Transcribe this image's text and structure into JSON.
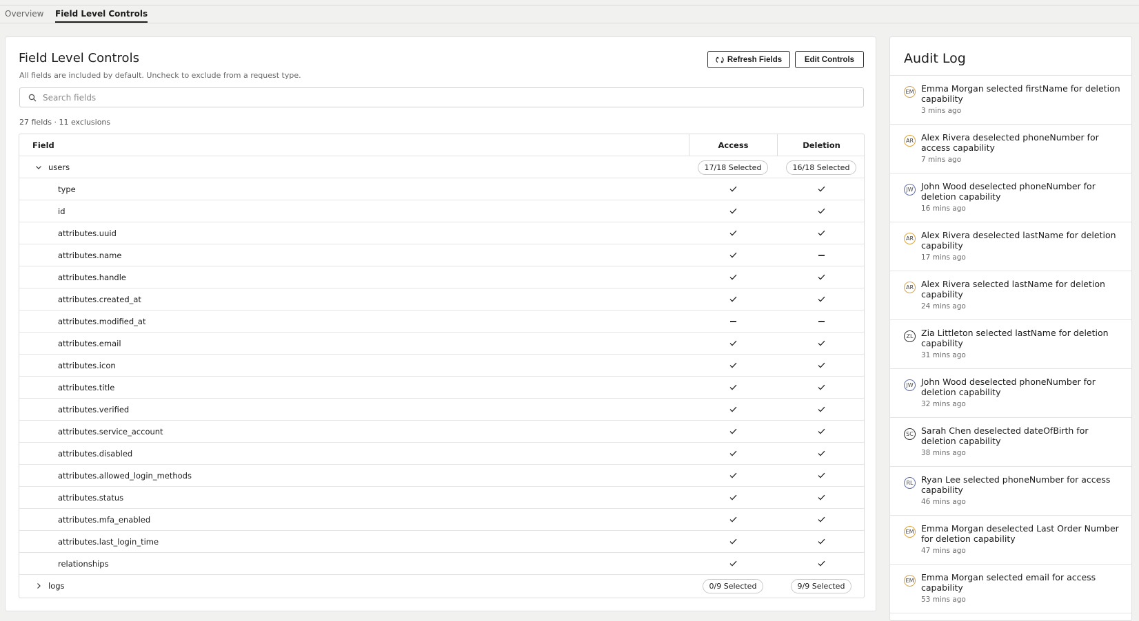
{
  "tabs": [
    {
      "label": "Overview"
    },
    {
      "label": "Field Level Controls"
    }
  ],
  "main": {
    "title": "Field Level Controls",
    "subtitle": "All fields are included by default. Uncheck to exclude from a request type.",
    "refresh_label": "Refresh Fields",
    "edit_label": "Edit Controls",
    "search_placeholder": "Search fields",
    "counts": "27 fields · 11 exclusions"
  },
  "table": {
    "headers": {
      "field": "Field",
      "access": "Access",
      "deletion": "Deletion"
    },
    "groups": [
      {
        "name": "users",
        "expanded": true,
        "access": "17/18 Selected",
        "deletion": "16/18 Selected"
      },
      {
        "name": "logs",
        "expanded": false,
        "access": "0/9 Selected",
        "deletion": "9/9 Selected"
      }
    ],
    "rows": [
      {
        "field": "type",
        "access": "check",
        "deletion": "check"
      },
      {
        "field": "id",
        "access": "check",
        "deletion": "check"
      },
      {
        "field": "attributes.uuid",
        "access": "check",
        "deletion": "check"
      },
      {
        "field": "attributes.name",
        "access": "check",
        "deletion": "dash"
      },
      {
        "field": "attributes.handle",
        "access": "check",
        "deletion": "check"
      },
      {
        "field": "attributes.created_at",
        "access": "check",
        "deletion": "check"
      },
      {
        "field": "attributes.modified_at",
        "access": "dash",
        "deletion": "dash"
      },
      {
        "field": "attributes.email",
        "access": "check",
        "deletion": "check"
      },
      {
        "field": "attributes.icon",
        "access": "check",
        "deletion": "check"
      },
      {
        "field": "attributes.title",
        "access": "check",
        "deletion": "check"
      },
      {
        "field": "attributes.verified",
        "access": "check",
        "deletion": "check"
      },
      {
        "field": "attributes.service_account",
        "access": "check",
        "deletion": "check"
      },
      {
        "field": "attributes.disabled",
        "access": "check",
        "deletion": "check"
      },
      {
        "field": "attributes.allowed_login_methods",
        "access": "check",
        "deletion": "check"
      },
      {
        "field": "attributes.status",
        "access": "check",
        "deletion": "check"
      },
      {
        "field": "attributes.mfa_enabled",
        "access": "check",
        "deletion": "check"
      },
      {
        "field": "attributes.last_login_time",
        "access": "check",
        "deletion": "check"
      },
      {
        "field": "relationships",
        "access": "check",
        "deletion": "check"
      }
    ]
  },
  "audit": {
    "title": "Audit Log",
    "entries": [
      {
        "initials": "EM",
        "color": "#d9a441",
        "text": "Emma Morgan selected firstName for deletion capability",
        "time": "3 mins ago"
      },
      {
        "initials": "AR",
        "color": "#d9a441",
        "text": "Alex Rivera deselected phoneNumber for access capability",
        "time": "7 mins ago"
      },
      {
        "initials": "JW",
        "color": "#5b6fb3",
        "text": "John Wood deselected phoneNumber for deletion capability",
        "time": "16 mins ago"
      },
      {
        "initials": "AR",
        "color": "#d9a441",
        "text": "Alex Rivera deselected lastName for deletion capability",
        "time": "17 mins ago"
      },
      {
        "initials": "AR",
        "color": "#d9a441",
        "text": "Alex Rivera selected lastName for deletion capability",
        "time": "24 mins ago"
      },
      {
        "initials": "ZL",
        "color": "#333333",
        "text": "Zia Littleton selected lastName for deletion capability",
        "time": "31 mins ago"
      },
      {
        "initials": "JW",
        "color": "#5b6fb3",
        "text": "John Wood deselected phoneNumber for deletion capability",
        "time": "32 mins ago"
      },
      {
        "initials": "SC",
        "color": "#333333",
        "text": "Sarah Chen deselected dateOfBirth for deletion capability",
        "time": "38 mins ago"
      },
      {
        "initials": "RL",
        "color": "#5b6fb3",
        "text": "Ryan Lee selected phoneNumber for access capability",
        "time": "46 mins ago"
      },
      {
        "initials": "EM",
        "color": "#d9a441",
        "text": "Emma Morgan deselected Last Order Number for deletion capability",
        "time": "47 mins ago"
      },
      {
        "initials": "EM",
        "color": "#d9a441",
        "text": "Emma Morgan selected email for access capability",
        "time": "53 mins ago"
      }
    ]
  }
}
